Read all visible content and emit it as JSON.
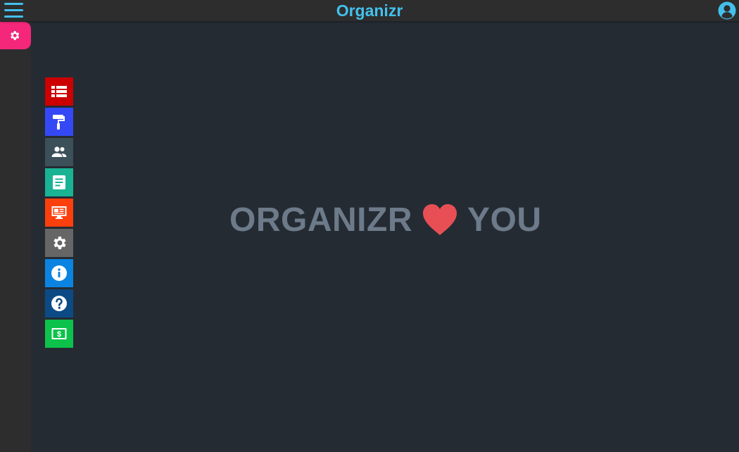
{
  "header": {
    "brand": "Organizr",
    "brand_color": "#43c0ec",
    "menu_icon": "hamburger-icon",
    "user_icon": "user-circle-icon"
  },
  "sidebar": {
    "active_item": {
      "icon": "gear-icon",
      "color": "#f4277a"
    }
  },
  "settings_tiles": [
    {
      "icon": "tab-list-icon",
      "color": "#cc0000"
    },
    {
      "icon": "paint-roller-icon",
      "color": "#3449f5"
    },
    {
      "icon": "users-icon",
      "color": "#3c5059"
    },
    {
      "icon": "note-icon",
      "color": "#19b394"
    },
    {
      "icon": "monitor-icon",
      "color": "#fb3f0d"
    },
    {
      "icon": "gear-icon",
      "color": "#666666"
    },
    {
      "icon": "info-icon",
      "color": "#0a84e0"
    },
    {
      "icon": "help-icon",
      "color": "#0b4a84"
    },
    {
      "icon": "donate-icon",
      "color": "#0cc24b"
    }
  ],
  "hero": {
    "left_text": "ORGANIZR",
    "right_text": "YOU",
    "heart_icon": "heart-icon",
    "heart_color": "#e84f55",
    "text_color": "#6c7a89"
  }
}
